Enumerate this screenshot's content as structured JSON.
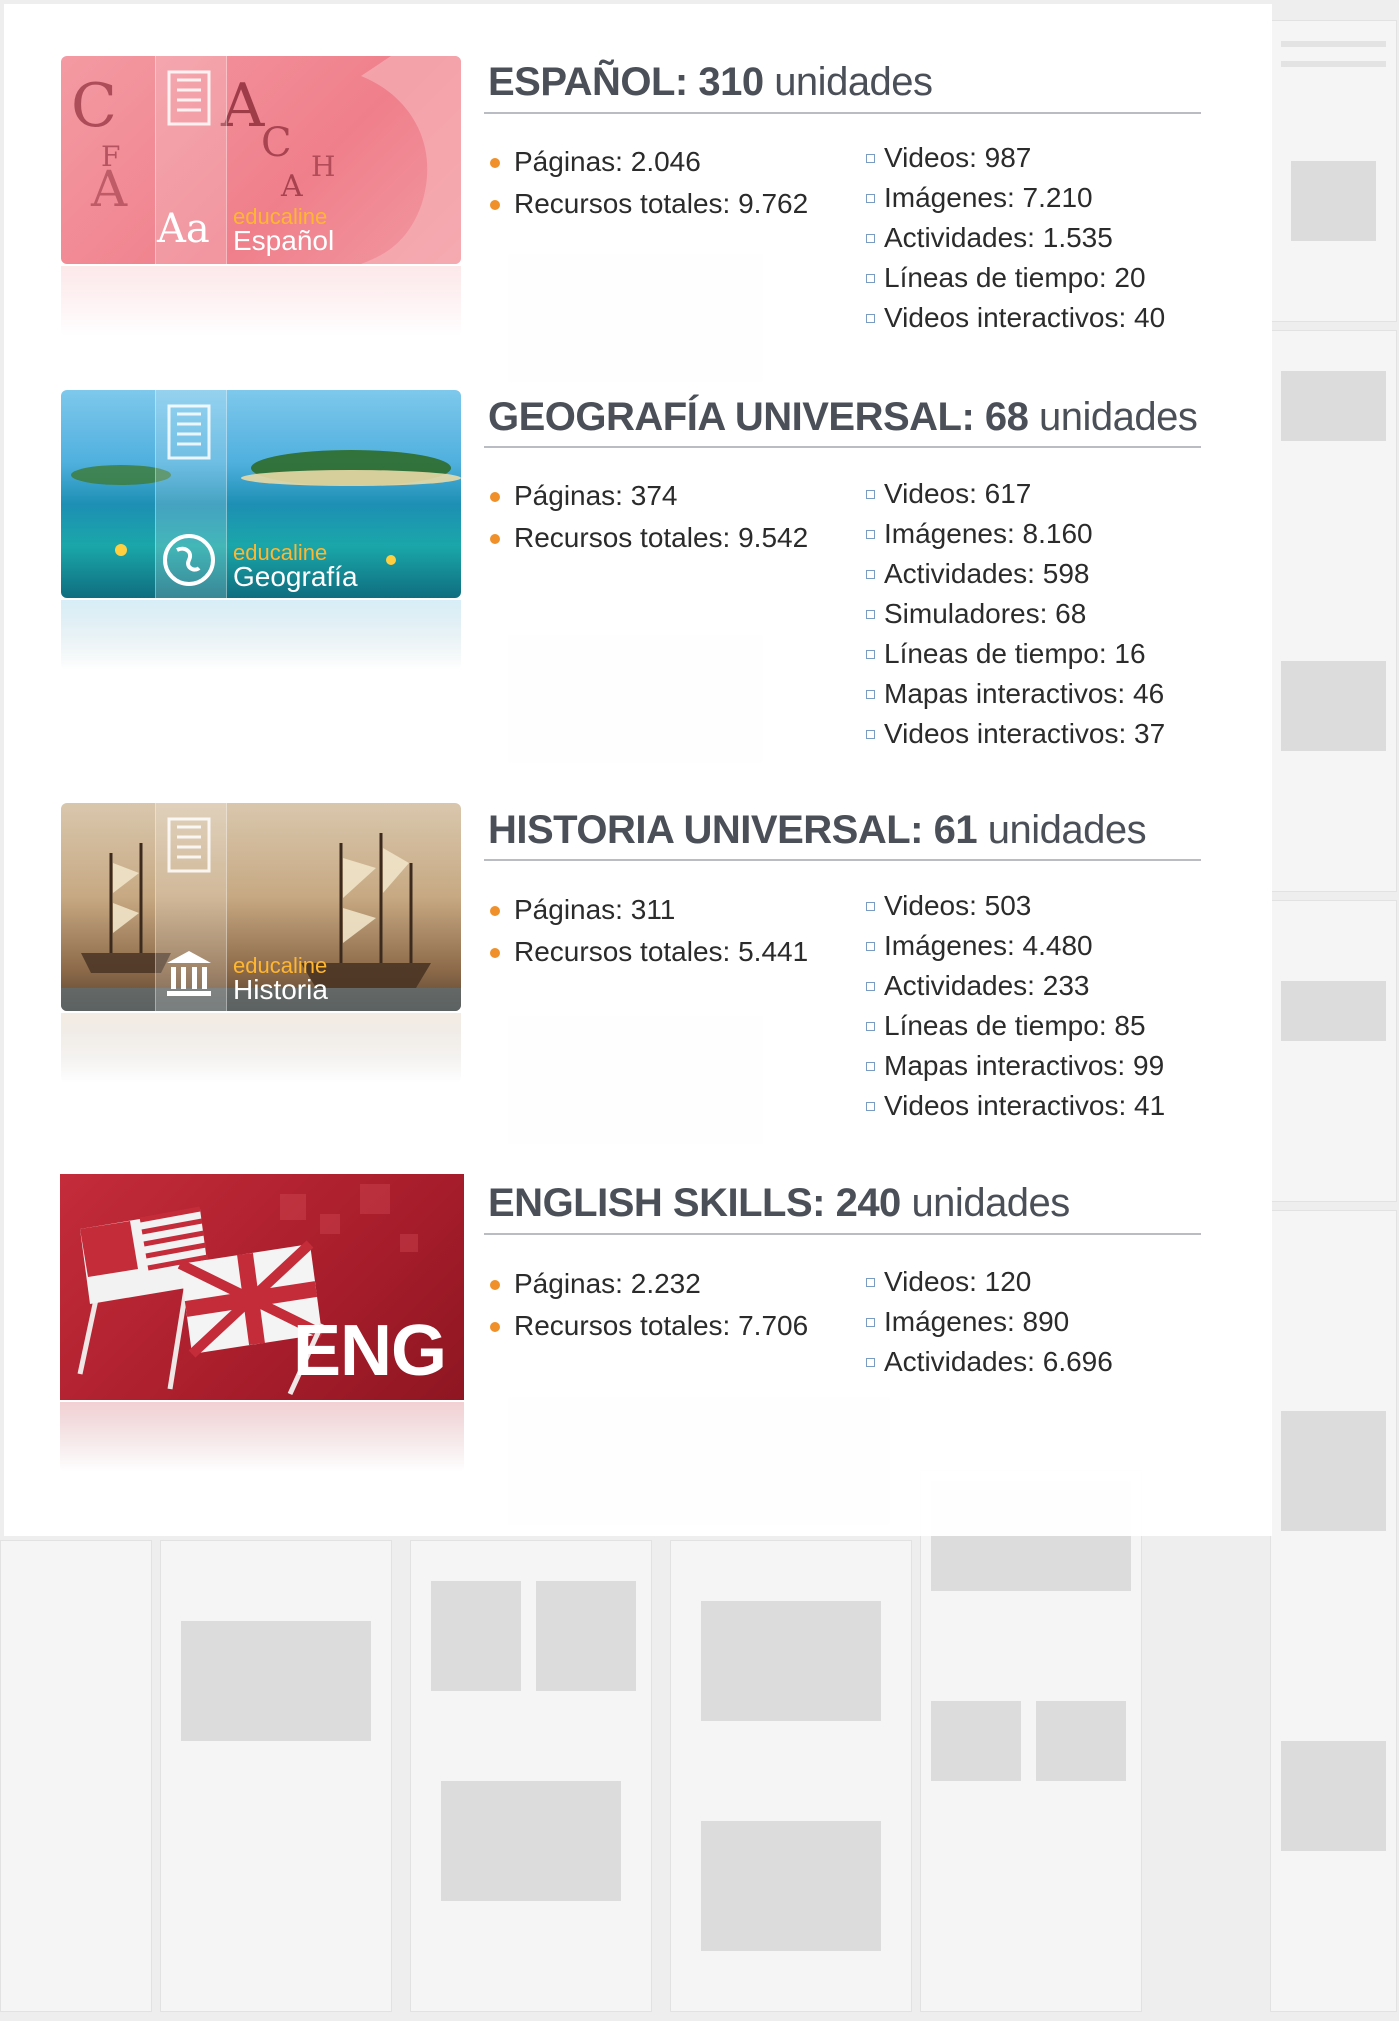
{
  "colors": {
    "accent_bullet": "#f0902b",
    "title_text": "#4a4f58",
    "brand_orange": "#ffb630",
    "espanol_bg": "#f08a93",
    "geografia_bg": "#2aa3c4",
    "historia_bg": "#b78a5a",
    "english_bg": "#b0222f"
  },
  "sections": [
    {
      "id": "espanol",
      "thumb": {
        "brand": "educaline",
        "subject": "Español",
        "badge": "Aa",
        "icon": "letters-icon"
      },
      "title_bold": "ESPAÑOL: 310",
      "title_rest": "unidades",
      "left_stats": [
        "Páginas: 2.046",
        "Recursos totales: 9.762"
      ],
      "right_stats": [
        "Videos: 987",
        "Imágenes: 7.210",
        "Actividades: 1.535",
        "Líneas de tiempo: 20",
        "Videos interactivos: 40"
      ]
    },
    {
      "id": "geografia",
      "thumb": {
        "brand": "educaline",
        "subject": "Geografía",
        "icon": "globe-icon"
      },
      "title_bold": "GEOGRAFÍA UNIVERSAL: 68",
      "title_rest": "unidades",
      "left_stats": [
        "Páginas: 374",
        "Recursos totales: 9.542"
      ],
      "right_stats": [
        "Videos: 617",
        "Imágenes: 8.160",
        "Actividades: 598",
        "Simuladores: 68",
        "Líneas de tiempo: 16",
        "Mapas interactivos: 46",
        "Videos interactivos: 37"
      ]
    },
    {
      "id": "historia",
      "thumb": {
        "brand": "educaline",
        "subject": "Historia",
        "icon": "museum-icon"
      },
      "title_bold": "HISTORIA UNIVERSAL: 61",
      "title_rest": "unidades",
      "left_stats": [
        "Páginas: 311",
        "Recursos totales: 5.441"
      ],
      "right_stats": [
        "Videos: 503",
        "Imágenes: 4.480",
        "Actividades: 233",
        "Líneas de tiempo: 85",
        "Mapas interactivos: 99",
        "Videos interactivos: 41"
      ]
    },
    {
      "id": "english",
      "thumb": {
        "label": "ENG",
        "icon": "flags-icon"
      },
      "title_bold": "ENGLISH SKILLS: 240",
      "title_rest": "unidades",
      "left_stats": [
        "Páginas: 2.232",
        "Recursos totales: 7.706"
      ],
      "right_stats": [
        "Videos: 120",
        "Imágenes: 890",
        "Actividades: 6.696"
      ]
    }
  ]
}
